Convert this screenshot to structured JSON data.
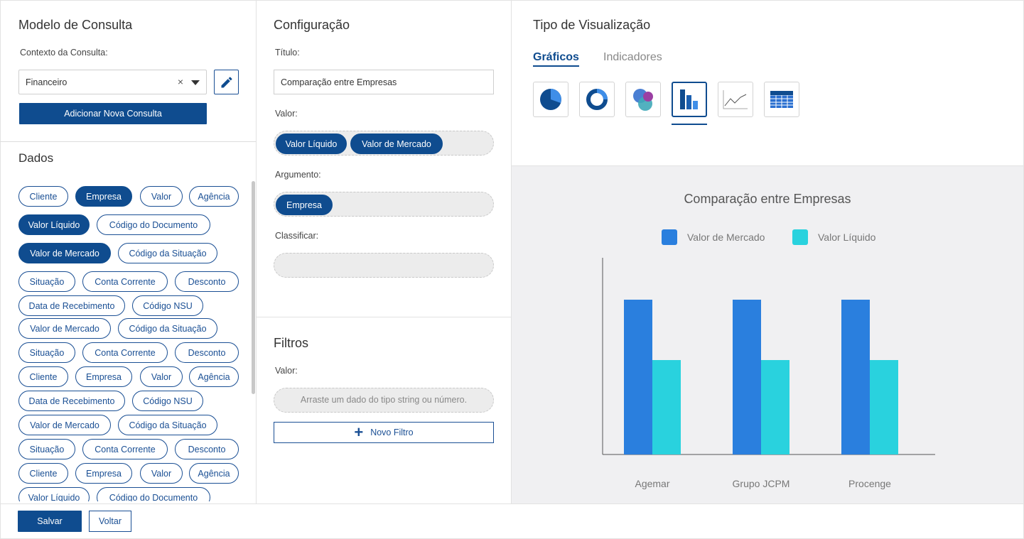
{
  "modelo": {
    "title": "Modelo de Consulta",
    "context_label": "Contexto da Consulta:",
    "context_value": "Financeiro",
    "clear_glyph": "×",
    "add_button": "Adicionar Nova Consulta"
  },
  "dados": {
    "title": "Dados",
    "chips": [
      {
        "label": "Cliente",
        "filled": false
      },
      {
        "label": "Empresa",
        "filled": true
      },
      {
        "label": "Valor",
        "filled": false
      },
      {
        "label": "Agência",
        "filled": false
      },
      {
        "label": "Valor Líquido",
        "filled": true
      },
      {
        "label": "Código do Documento",
        "filled": false
      },
      {
        "label": "Valor de Mercado",
        "filled": true
      },
      {
        "label": "Código da Situação",
        "filled": false
      },
      {
        "label": "Situação",
        "filled": false
      },
      {
        "label": "Conta Corrente",
        "filled": false
      },
      {
        "label": "Desconto",
        "filled": false
      },
      {
        "label": "Data de Recebimento",
        "filled": false
      },
      {
        "label": "Código NSU",
        "filled": false
      },
      {
        "label": "Valor de Mercado",
        "filled": false
      },
      {
        "label": "Código da Situação",
        "filled": false
      },
      {
        "label": "Situação",
        "filled": false
      },
      {
        "label": "Conta Corrente",
        "filled": false
      },
      {
        "label": "Desconto",
        "filled": false
      },
      {
        "label": "Cliente",
        "filled": false
      },
      {
        "label": "Empresa",
        "filled": false
      },
      {
        "label": "Valor",
        "filled": false
      },
      {
        "label": "Agência",
        "filled": false
      },
      {
        "label": "Data de Recebimento",
        "filled": false
      },
      {
        "label": "Código NSU",
        "filled": false
      },
      {
        "label": "Valor de Mercado",
        "filled": false
      },
      {
        "label": "Código da Situação",
        "filled": false
      },
      {
        "label": "Situação",
        "filled": false
      },
      {
        "label": "Conta Corrente",
        "filled": false
      },
      {
        "label": "Desconto",
        "filled": false
      },
      {
        "label": "Cliente",
        "filled": false
      },
      {
        "label": "Empresa",
        "filled": false
      },
      {
        "label": "Valor",
        "filled": false
      },
      {
        "label": "Agência",
        "filled": false
      },
      {
        "label": "Valor Líquido",
        "filled": false
      },
      {
        "label": "Código do Documento",
        "filled": false
      }
    ]
  },
  "config": {
    "title": "Configuração",
    "titulo_label": "Título:",
    "titulo_value": "Comparação entre Empresas",
    "valor_label": "Valor:",
    "valor_chips": [
      "Valor Líquido",
      "Valor de Mercado"
    ],
    "argumento_label": "Argumento:",
    "argumento_chips": [
      "Empresa"
    ],
    "classificar_label": "Classificar:"
  },
  "filtros": {
    "title": "Filtros",
    "valor_label": "Valor:",
    "placeholder": "Arraste um dado do tipo string ou número.",
    "new_filter": "Novo Filtro",
    "plus_glyph": "+"
  },
  "viz": {
    "title": "Tipo de Visualização",
    "tabs": [
      "Gráficos",
      "Indicadores"
    ],
    "active_tab": "Gráficos",
    "types": [
      "pie-chart-icon",
      "donut-chart-icon",
      "bubble-chart-icon",
      "bar-chart-icon",
      "line-chart-icon",
      "table-icon"
    ],
    "active_type": "bar-chart-icon"
  },
  "colors": {
    "primary": "#0f4c8f",
    "series_mercado": "#2a7fde",
    "series_liquido": "#29d2de"
  },
  "chart_data": {
    "type": "bar",
    "title": "Comparação entre Empresas",
    "categories": [
      "Agemar",
      "Grupo JCPM",
      "Procenge"
    ],
    "series": [
      {
        "name": "Valor de Mercado",
        "values": [
          1,
          1,
          1
        ]
      },
      {
        "name": "Valor Líquido",
        "values": [
          0.61,
          0.61,
          0.61
        ]
      }
    ],
    "legend": "top",
    "grid": false
  },
  "footer": {
    "save": "Salvar",
    "back": "Voltar"
  }
}
